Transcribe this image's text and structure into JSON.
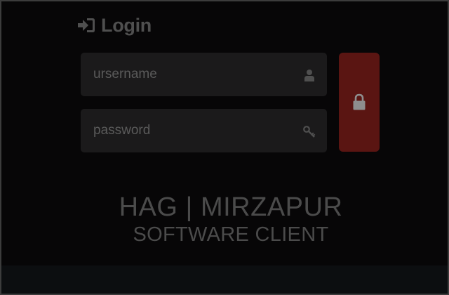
{
  "heading": {
    "icon": "sign-in-icon",
    "title": "Login"
  },
  "form": {
    "username": {
      "placeholder": "ursername",
      "value": "",
      "icon": "user-icon"
    },
    "password": {
      "placeholder": "password",
      "value": "",
      "icon": "key-icon"
    },
    "submit": {
      "icon": "lock-icon"
    }
  },
  "brand": {
    "title": "HAG | MIRZAPUR",
    "subtitle": "SOFTWARE CLIENT"
  },
  "colors": {
    "background": "#070607",
    "field": "#1b1a1b",
    "submit": "#5a1512",
    "text": "#4b4b4b",
    "icon": "#4f4f4f"
  }
}
